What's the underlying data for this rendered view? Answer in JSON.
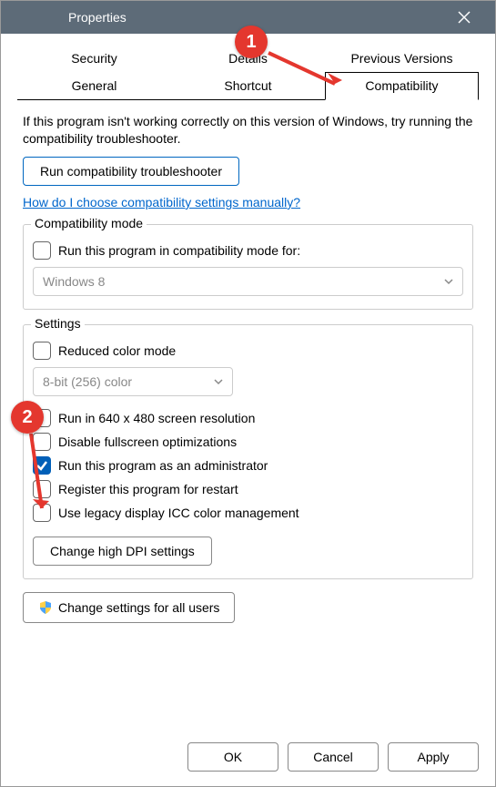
{
  "window": {
    "title": "Properties"
  },
  "tabs": {
    "security": "Security",
    "details": "Details",
    "previous": "Previous Versions",
    "general": "General",
    "shortcut": "Shortcut",
    "compatibility": "Compatibility"
  },
  "intro": "If this program isn't working correctly on this version of Windows, try running the compatibility troubleshooter.",
  "troubleshooter_btn": "Run compatibility troubleshooter",
  "help_link": "How do I choose compatibility settings manually?",
  "compat_group": {
    "title": "Compatibility mode",
    "checkbox": "Run this program in compatibility mode for:",
    "select": "Windows 8"
  },
  "settings_group": {
    "title": "Settings",
    "reduced_color": "Reduced color mode",
    "color_select": "8-bit (256) color",
    "low_res": "Run in 640 x 480 screen resolution",
    "disable_fs": "Disable fullscreen optimizations",
    "admin": "Run this program as an administrator",
    "register": "Register this program for restart",
    "legacy_icc": "Use legacy display ICC color management",
    "dpi_btn": "Change high DPI settings"
  },
  "all_users_btn": "Change settings for all users",
  "footer": {
    "ok": "OK",
    "cancel": "Cancel",
    "apply": "Apply"
  },
  "annotations": {
    "one": "1",
    "two": "2"
  }
}
